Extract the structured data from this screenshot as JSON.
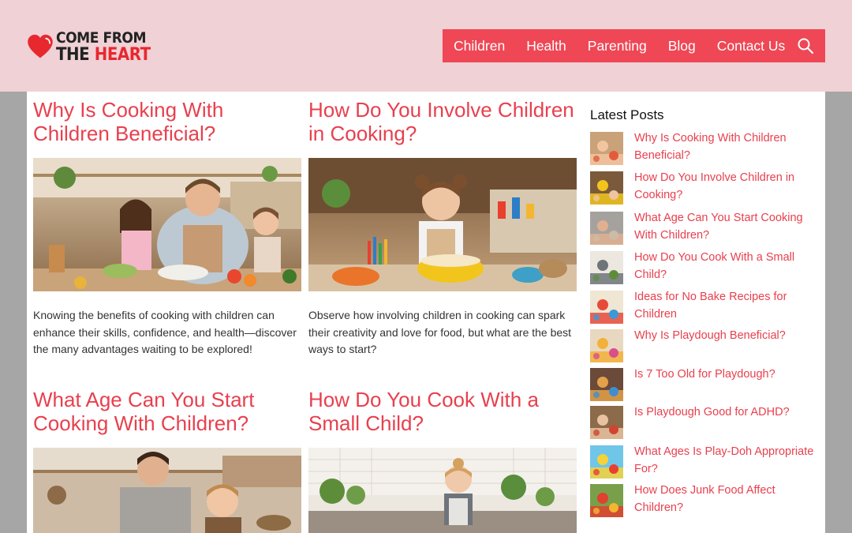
{
  "header": {
    "logo": {
      "line1": "COME FROM",
      "line2_a": "THE ",
      "line2_b": "HEART"
    },
    "nav": [
      "Children",
      "Health",
      "Parenting",
      "Blog",
      "Contact Us"
    ],
    "colors": {
      "header_bg": "#efd1d6",
      "nav_bg": "#ef4755",
      "accent": "#e8404e"
    }
  },
  "posts": [
    {
      "title": "Why Is Cooking With Children Beneficial?",
      "excerpt": "Knowing the benefits of cooking with children can enhance their skills, confidence, and health—discover the many advantages waiting to be explored!"
    },
    {
      "title": "How Do You Involve Children in Cooking?",
      "excerpt": "Observe how involving children in cooking can spark their creativity and love for food, but what are the best ways to start?"
    },
    {
      "title": "What Age Can You Start Cooking With Children?",
      "excerpt": ""
    },
    {
      "title": "How Do You Cook With a Small Child?",
      "excerpt": ""
    }
  ],
  "sidebar": {
    "heading": "Latest Posts",
    "items": [
      "Why Is Cooking With Children Beneficial?",
      "How Do You Involve Children in Cooking?",
      "What Age Can You Start Cooking With Children?",
      "How Do You Cook With a Small Child?",
      "Ideas for No Bake Recipes for Children",
      "Why Is Playdough Beneficial?",
      "Is 7 Too Old for Playdough?",
      "Is Playdough Good for ADHD?",
      "What Ages Is Play-Doh Appropriate For?",
      "How Does Junk Food Affect Children?"
    ]
  }
}
